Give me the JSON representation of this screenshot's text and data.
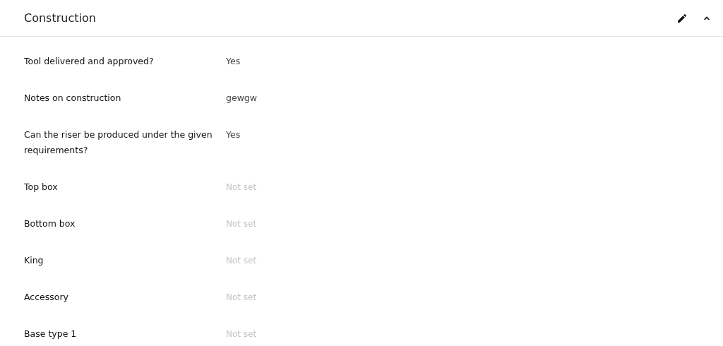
{
  "panel": {
    "title": "Construction",
    "expanded": true
  },
  "fields": [
    {
      "label": "Tool delivered and approved?",
      "value": "Yes",
      "empty": false
    },
    {
      "label": "Notes on construction",
      "value": "gewgw",
      "empty": false
    },
    {
      "label": "Can the riser be produced under the given requirements?",
      "value": "Yes",
      "empty": false
    },
    {
      "label": "Top box",
      "value": "Not set",
      "empty": true
    },
    {
      "label": "Bottom box",
      "value": "Not set",
      "empty": true
    },
    {
      "label": "King",
      "value": "Not set",
      "empty": true
    },
    {
      "label": "Accessory",
      "value": "Not set",
      "empty": true
    },
    {
      "label": "Base type 1",
      "value": "Not set",
      "empty": true
    }
  ]
}
